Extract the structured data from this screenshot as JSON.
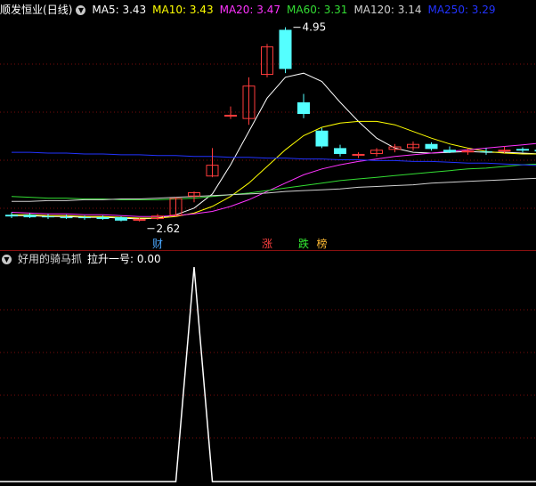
{
  "main_header": {
    "stock_name": "顺发恒业",
    "period": "(日线)",
    "ma": [
      {
        "label": "MA5: 3.43",
        "color": "#ffffff"
      },
      {
        "label": "MA10: 3.43",
        "color": "#ffff00"
      },
      {
        "label": "MA20: 3.47",
        "color": "#ff33ff"
      },
      {
        "label": "MA60: 3.31",
        "color": "#33dd33"
      },
      {
        "label": "MA120: 3.14",
        "color": "#d0d0d0"
      },
      {
        "label": "MA250: 3.29",
        "color": "#2233ff"
      }
    ]
  },
  "price_annotations": {
    "high": "4.95",
    "low": "2.62"
  },
  "event_markers": [
    {
      "label": "财",
      "color": "#4aa8ff"
    },
    {
      "label": "涨",
      "color": "#ff4040"
    },
    {
      "label": "跌",
      "color": "#33ee33"
    },
    {
      "label": "榜",
      "color": "#ffbb33"
    }
  ],
  "indicator_header": {
    "name": "好用的骑马抓",
    "value_label": "拉升一号: 0.00"
  },
  "colors": {
    "up": "#ff3c3c",
    "down": "#54ffff",
    "grid": "#7a0d0d",
    "separator": "#8a1010"
  },
  "chart_data": {
    "type": "candlestick",
    "price_range": [
      2.5,
      5.0
    ],
    "candles": [
      {
        "o": 2.7,
        "h": 2.73,
        "l": 2.66,
        "c": 2.68
      },
      {
        "o": 2.7,
        "h": 2.72,
        "l": 2.66,
        "c": 2.67
      },
      {
        "o": 2.68,
        "h": 2.71,
        "l": 2.65,
        "c": 2.67
      },
      {
        "o": 2.67,
        "h": 2.7,
        "l": 2.65,
        "c": 2.66
      },
      {
        "o": 2.67,
        "h": 2.69,
        "l": 2.64,
        "c": 2.66
      },
      {
        "o": 2.67,
        "h": 2.69,
        "l": 2.64,
        "c": 2.65
      },
      {
        "o": 2.67,
        "h": 2.68,
        "l": 2.62,
        "c": 2.63
      },
      {
        "o": 2.63,
        "h": 2.66,
        "l": 2.62,
        "c": 2.65
      },
      {
        "o": 2.65,
        "h": 2.71,
        "l": 2.64,
        "c": 2.69
      },
      {
        "o": 2.69,
        "h": 2.91,
        "l": 2.68,
        "c": 2.9
      },
      {
        "o": 2.92,
        "h": 2.98,
        "l": 2.85,
        "c": 2.97
      },
      {
        "o": 3.16,
        "h": 3.5,
        "l": 3.15,
        "c": 3.3
      },
      {
        "o": 3.9,
        "h": 4.0,
        "l": 3.85,
        "c": 3.9
      },
      {
        "o": 3.85,
        "h": 4.35,
        "l": 3.78,
        "c": 4.25
      },
      {
        "o": 4.38,
        "h": 4.75,
        "l": 4.35,
        "c": 4.72
      },
      {
        "o": 4.92,
        "h": 4.95,
        "l": 4.4,
        "c": 4.45
      },
      {
        "o": 4.05,
        "h": 4.15,
        "l": 3.86,
        "c": 3.91
      },
      {
        "o": 3.71,
        "h": 3.74,
        "l": 3.5,
        "c": 3.52
      },
      {
        "o": 3.5,
        "h": 3.54,
        "l": 3.4,
        "c": 3.43
      },
      {
        "o": 3.42,
        "h": 3.45,
        "l": 3.38,
        "c": 3.43
      },
      {
        "o": 3.43,
        "h": 3.5,
        "l": 3.4,
        "c": 3.48
      },
      {
        "o": 3.48,
        "h": 3.55,
        "l": 3.45,
        "c": 3.52
      },
      {
        "o": 3.5,
        "h": 3.58,
        "l": 3.47,
        "c": 3.55
      },
      {
        "o": 3.55,
        "h": 3.57,
        "l": 3.47,
        "c": 3.49
      },
      {
        "o": 3.48,
        "h": 3.52,
        "l": 3.44,
        "c": 3.45
      },
      {
        "o": 3.45,
        "h": 3.5,
        "l": 3.42,
        "c": 3.47
      },
      {
        "o": 3.46,
        "h": 3.5,
        "l": 3.42,
        "c": 3.45
      },
      {
        "o": 3.46,
        "h": 3.52,
        "l": 3.44,
        "c": 3.48
      },
      {
        "o": 3.49,
        "h": 3.51,
        "l": 3.45,
        "c": 3.47
      },
      {
        "o": 3.48,
        "h": 3.5,
        "l": 3.44,
        "c": 3.46
      }
    ],
    "ma_lines": [
      {
        "name": "MA5",
        "color": "#ffffff",
        "values": [
          2.69,
          2.69,
          2.68,
          2.68,
          2.67,
          2.67,
          2.66,
          2.65,
          2.66,
          2.7,
          2.78,
          2.95,
          3.3,
          3.7,
          4.1,
          4.35,
          4.4,
          4.3,
          4.05,
          3.82,
          3.62,
          3.5,
          3.45,
          3.44,
          3.45,
          3.46,
          3.45,
          3.45,
          3.44,
          3.43
        ]
      },
      {
        "name": "MA10",
        "color": "#ffff00",
        "values": [
          2.7,
          2.7,
          2.69,
          2.69,
          2.68,
          2.68,
          2.67,
          2.66,
          2.66,
          2.68,
          2.72,
          2.8,
          2.92,
          3.08,
          3.28,
          3.48,
          3.65,
          3.75,
          3.8,
          3.82,
          3.82,
          3.78,
          3.7,
          3.62,
          3.55,
          3.5,
          3.46,
          3.44,
          3.43,
          3.43
        ]
      },
      {
        "name": "MA20",
        "color": "#ff33ff",
        "values": [
          2.73,
          2.72,
          2.71,
          2.71,
          2.7,
          2.7,
          2.69,
          2.68,
          2.68,
          2.69,
          2.71,
          2.74,
          2.8,
          2.88,
          2.98,
          3.08,
          3.18,
          3.25,
          3.3,
          3.34,
          3.37,
          3.4,
          3.42,
          3.44,
          3.46,
          3.48,
          3.5,
          3.52,
          3.54,
          3.56
        ]
      },
      {
        "name": "MA60",
        "color": "#33dd33",
        "values": [
          2.92,
          2.91,
          2.9,
          2.9,
          2.89,
          2.89,
          2.88,
          2.88,
          2.88,
          2.89,
          2.9,
          2.92,
          2.94,
          2.96,
          2.99,
          3.02,
          3.05,
          3.08,
          3.11,
          3.13,
          3.15,
          3.17,
          3.19,
          3.21,
          3.23,
          3.25,
          3.26,
          3.28,
          3.3,
          3.31
        ]
      },
      {
        "name": "MA120",
        "color": "#d0d0d0",
        "values": [
          2.86,
          2.86,
          2.87,
          2.87,
          2.88,
          2.88,
          2.89,
          2.89,
          2.9,
          2.91,
          2.92,
          2.93,
          2.94,
          2.95,
          2.96,
          2.98,
          2.99,
          3.0,
          3.01,
          3.03,
          3.04,
          3.05,
          3.06,
          3.08,
          3.09,
          3.1,
          3.11,
          3.12,
          3.13,
          3.14
        ]
      },
      {
        "name": "MA250",
        "color": "#2233ff",
        "values": [
          3.45,
          3.45,
          3.44,
          3.44,
          3.43,
          3.43,
          3.42,
          3.42,
          3.41,
          3.41,
          3.4,
          3.4,
          3.39,
          3.39,
          3.38,
          3.38,
          3.37,
          3.37,
          3.36,
          3.36,
          3.35,
          3.35,
          3.34,
          3.34,
          3.33,
          3.32,
          3.32,
          3.31,
          3.3,
          3.29
        ]
      }
    ],
    "marker_candle_index": [
      8,
      14,
      16,
      17
    ],
    "high_label_index": 15,
    "low_label_index": 7,
    "indicator": {
      "name": "拉升一号",
      "range": [
        0,
        1
      ],
      "values": [
        0,
        0,
        0,
        0,
        0,
        0,
        0,
        0,
        0,
        0,
        1,
        0,
        0,
        0,
        0,
        0,
        0,
        0,
        0,
        0,
        0,
        0,
        0,
        0,
        0,
        0,
        0,
        0,
        0,
        0
      ]
    }
  }
}
